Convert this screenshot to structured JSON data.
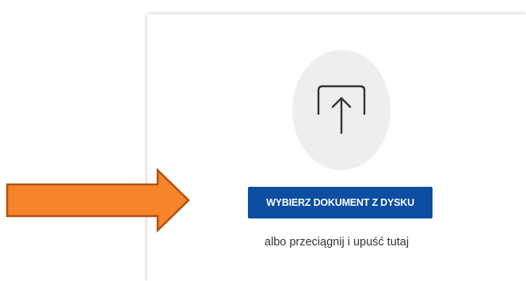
{
  "upload": {
    "icon": "upload-arrow-icon",
    "button_label": "WYBIERZ DOKUMENT Z DYSKU",
    "drop_hint": "albo przeciągnij i upuść tutaj"
  },
  "annotation": {
    "icon": "orange-arrow-icon",
    "fill_color": "#f5842a",
    "stroke_color": "#b5500f"
  },
  "colors": {
    "accent": "#0c4ea1",
    "circle": "#eeeeee"
  }
}
